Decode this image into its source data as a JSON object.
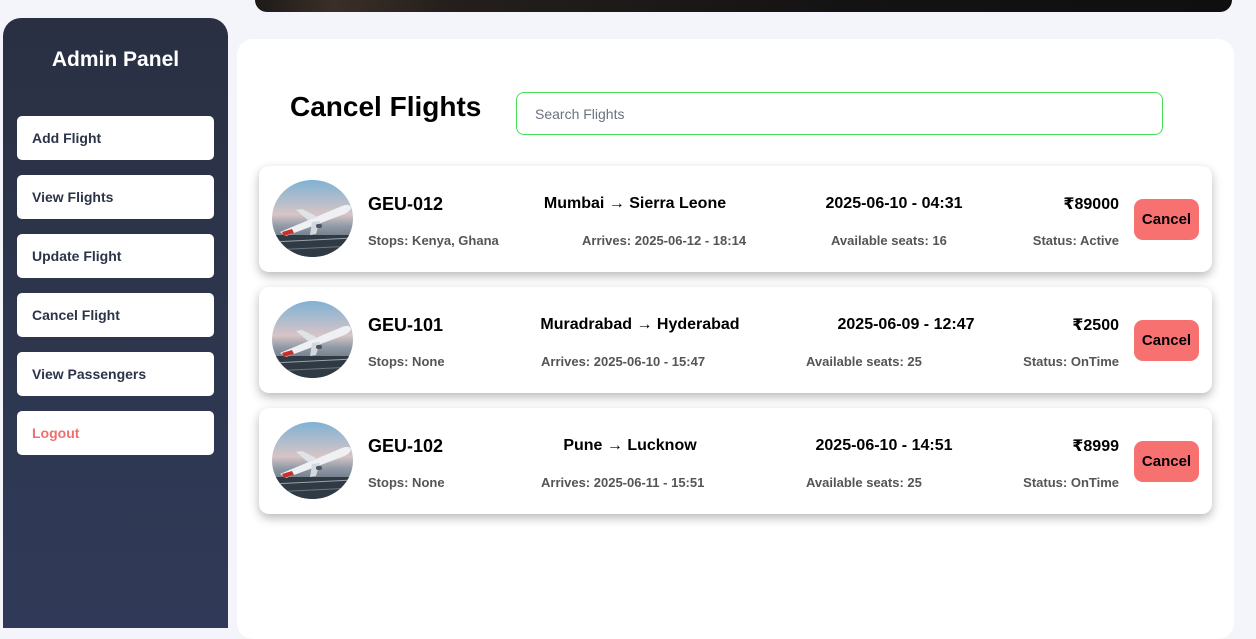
{
  "sidebar": {
    "title": "Admin Panel",
    "items": [
      {
        "label": "Add Flight"
      },
      {
        "label": "View Flights"
      },
      {
        "label": "Update Flight"
      },
      {
        "label": "Cancel Flight"
      },
      {
        "label": "View Passengers"
      },
      {
        "label": "Logout"
      }
    ]
  },
  "main": {
    "title": "Cancel Flights",
    "search_placeholder": "Search Flights",
    "search_value": "",
    "cancel_label": "Cancel",
    "flights": [
      {
        "code": "GEU-012",
        "route": "Mumbai → Sierra Leone",
        "departure": "2025-06-10 - 04:31",
        "price": "₹89000",
        "stops": "Stops: Kenya, Ghana",
        "arrives": "Arrives: 2025-06-12 - 18:14",
        "seats": "Available seats: 16",
        "status": "Status: Active"
      },
      {
        "code": "GEU-101",
        "route": "Muradrabad → Hyderabad",
        "departure": "2025-06-09 - 12:47",
        "price": "₹2500",
        "stops": "Stops: None",
        "arrives": "Arrives: 2025-06-10 - 15:47",
        "seats": "Available seats: 25",
        "status": "Status: OnTime"
      },
      {
        "code": "GEU-102",
        "route": "Pune → Lucknow",
        "departure": "2025-06-10 - 14:51",
        "price": "₹8999",
        "stops": "Stops: None",
        "arrives": "Arrives: 2025-06-11 - 15:51",
        "seats": "Available seats: 25",
        "status": "Status: OnTime"
      }
    ]
  },
  "colors": {
    "sidebar_bg": "#2e3750",
    "accent_cancel": "#f87171",
    "logout_text": "#ef6f6f",
    "search_border": "#4ade56"
  },
  "icons": {
    "flight_image": "airplane-takeoff-photo"
  }
}
